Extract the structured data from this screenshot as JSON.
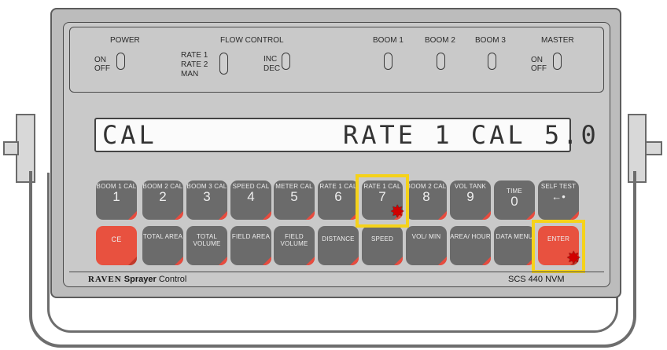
{
  "panel": {
    "power": {
      "title": "POWER",
      "on": "ON",
      "off": "OFF"
    },
    "flow_control": {
      "title": "FLOW CONTROL",
      "rate1": "RATE 1",
      "rate2": "RATE 2",
      "man": "MAN",
      "inc": "INC",
      "dec": "DEC"
    },
    "boom1": "BOOM 1",
    "boom2": "BOOM 2",
    "boom3": "BOOM 3",
    "master": {
      "title": "MASTER",
      "on": "ON",
      "off": "OFF"
    }
  },
  "display": {
    "left": "CAL",
    "right": "RATE 1 CAL 5.0"
  },
  "keys_row1": [
    {
      "label": "BOOM 1 CAL",
      "num": "1"
    },
    {
      "label": "BOOM 2 CAL",
      "num": "2"
    },
    {
      "label": "BOOM 3 CAL",
      "num": "3"
    },
    {
      "label": "SPEED CAL",
      "num": "4"
    },
    {
      "label": "METER CAL",
      "num": "5"
    },
    {
      "label": "RATE 1 CAL",
      "num": "6"
    },
    {
      "label": "RATE 1 CAL",
      "num": "7"
    },
    {
      "label": "BOOM 2 CAL",
      "num": "8"
    },
    {
      "label": "VOL TANK",
      "num": "9"
    },
    {
      "label": "TIME",
      "num": "0"
    },
    {
      "label": "SELF TEST",
      "num": "←•"
    }
  ],
  "keys_row2": [
    {
      "label": "CE"
    },
    {
      "label": "TOTAL AREA"
    },
    {
      "label": "TOTAL VOLUME"
    },
    {
      "label": "FIELD AREA"
    },
    {
      "label": "FIELD VOLUME"
    },
    {
      "label": "DISTANCE"
    },
    {
      "label": "SPEED"
    },
    {
      "label": "VOL/ MIN"
    },
    {
      "label": "AREA/ HOUR"
    },
    {
      "label": "DATA MENU"
    },
    {
      "label": "ENTER"
    }
  ],
  "footer": {
    "brand_raven": "RAVEN",
    "brand_product": "Sprayer",
    "brand_control": "Control",
    "model": "SCS 440 NVM"
  },
  "colors": {
    "highlight": "#f5d21a",
    "key": "#6b6b6b",
    "red_key": "#e8513f",
    "marker": "#d10000"
  },
  "markers": {
    "symbol": "✸"
  }
}
